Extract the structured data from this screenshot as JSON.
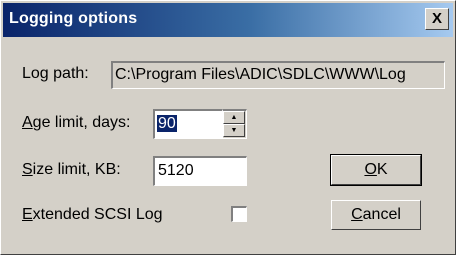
{
  "dialog": {
    "title": "Logging options",
    "close_glyph": "X"
  },
  "log_path": {
    "label": "Log path:",
    "value": "C:\\Program Files\\ADIC\\SDLC\\WWW\\Log"
  },
  "age_limit": {
    "label_mnemonic": "A",
    "label_rest": "ge limit, days:",
    "value": "90",
    "spin_up_glyph": "▲",
    "spin_down_glyph": "▼"
  },
  "size_limit": {
    "label_mnemonic": "S",
    "label_rest": "ize limit, KB:",
    "value": "5120"
  },
  "extended_scsi_log": {
    "label_mnemonic": "E",
    "label_rest": "xtended SCSI Log",
    "checked": false
  },
  "buttons": {
    "ok_mnemonic": "O",
    "ok_rest": "K",
    "cancel_mnemonic": "C",
    "cancel_rest": "ancel"
  },
  "colors": {
    "titlebar_start": "#0a246a",
    "titlebar_end": "#a6caf0",
    "face": "#d4d0c8",
    "selection": "#0a246a"
  }
}
